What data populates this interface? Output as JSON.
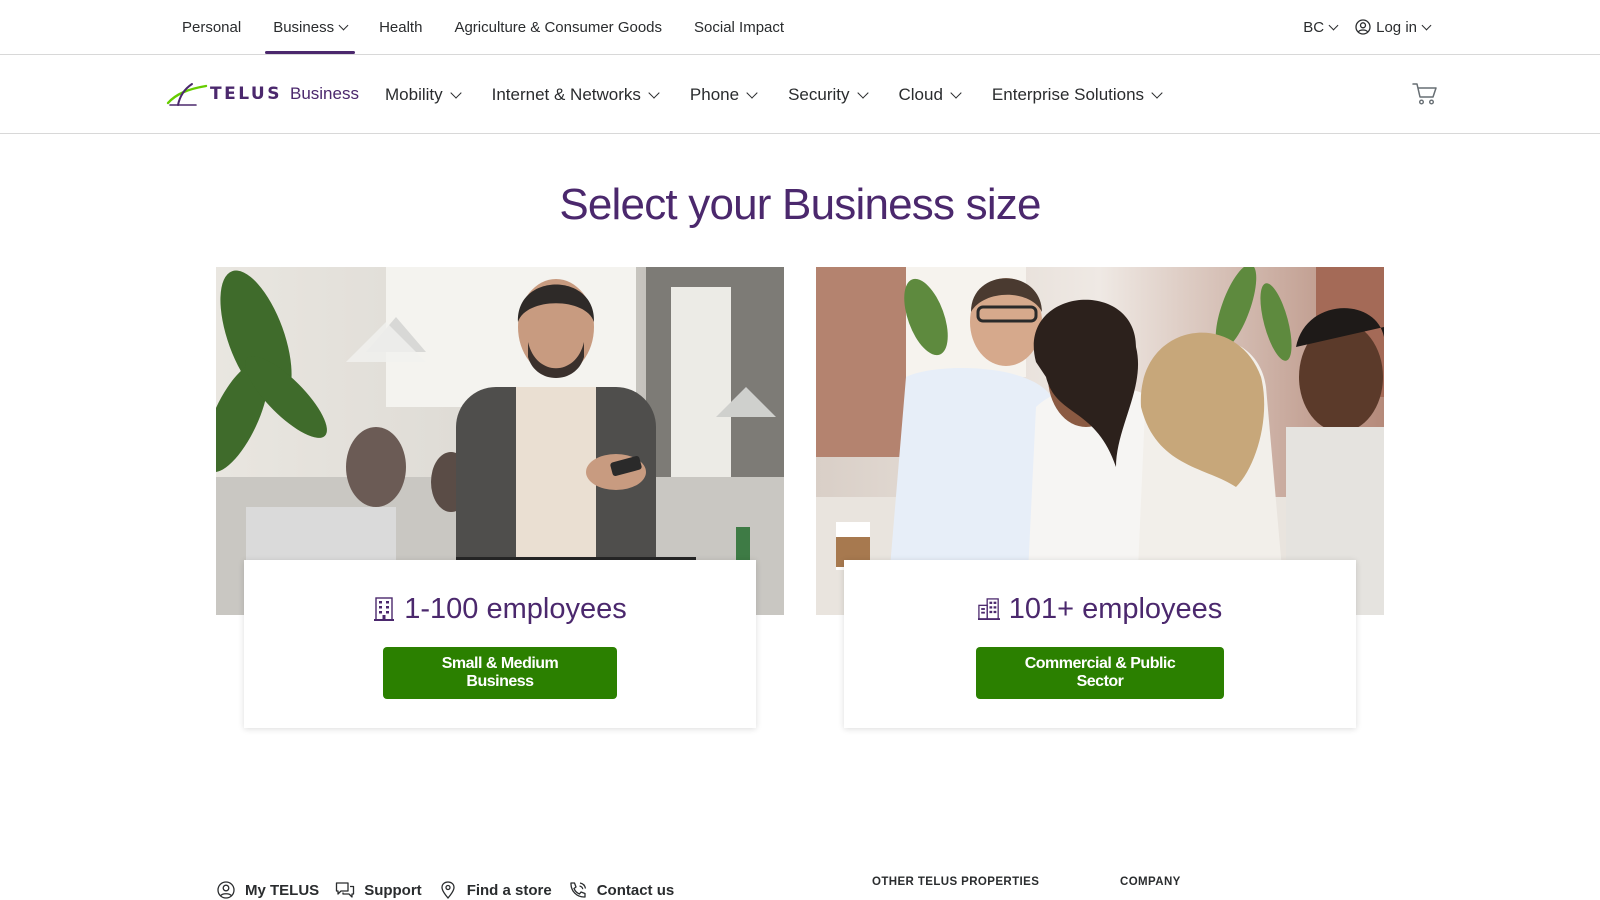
{
  "top_nav": {
    "items": [
      {
        "label": "Personal"
      },
      {
        "label": "Business",
        "active": true,
        "has_dropdown": true
      },
      {
        "label": "Health"
      },
      {
        "label": "Agriculture & Consumer Goods"
      },
      {
        "label": "Social Impact"
      }
    ],
    "region": "BC",
    "login": "Log in"
  },
  "brand": {
    "wordmark": "TELUS",
    "subtitle": "Business",
    "purple": "#4b286d",
    "green": "#2b8000"
  },
  "main_nav": {
    "items": [
      {
        "label": "Mobility"
      },
      {
        "label": "Internet & Networks"
      },
      {
        "label": "Phone"
      },
      {
        "label": "Security"
      },
      {
        "label": "Cloud"
      },
      {
        "label": "Enterprise Solutions"
      }
    ],
    "cart_icon": "cart-icon"
  },
  "hero": {
    "title": "Select your Business size"
  },
  "cards": [
    {
      "icon": "building-icon",
      "title": "1-100 employees",
      "button": "Small & Medium Business"
    },
    {
      "icon": "buildings-icon",
      "title": "101+ employees",
      "button": "Commercial & Public Sector"
    }
  ],
  "footer": {
    "links": [
      {
        "icon": "user-icon",
        "label": "My TELUS"
      },
      {
        "icon": "chat-icon",
        "label": "Support"
      },
      {
        "icon": "location-pin-icon",
        "label": "Find a store"
      },
      {
        "icon": "phone-icon",
        "label": "Contact us"
      }
    ],
    "headings": [
      "OTHER TELUS PROPERTIES",
      "COMPANY"
    ]
  }
}
